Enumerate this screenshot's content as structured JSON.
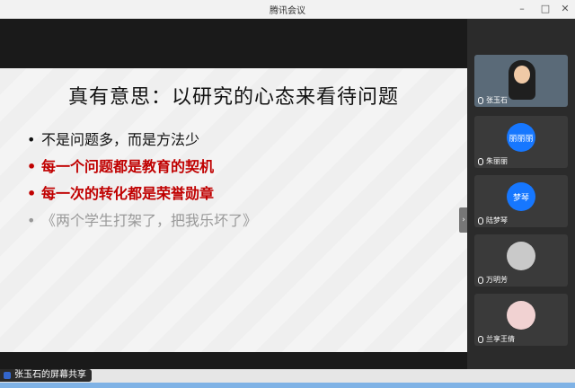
{
  "window": {
    "title": "腾讯会议",
    "controls": {
      "minimize": "–",
      "maximize": "□",
      "close": "✕"
    }
  },
  "slide": {
    "title": "真有意思：以研究的心态来看待问题",
    "bullets": [
      {
        "dot": "•",
        "text": "不是问题多，而是方法少"
      },
      {
        "dot": "•",
        "text": "每一个问题都是教育的契机"
      },
      {
        "dot": "•",
        "text": "每一次的转化都是荣誉勋章"
      },
      {
        "dot": "•",
        "text": "《两个学生打架了，把我乐坏了》"
      }
    ],
    "collapse_glyph": "›"
  },
  "participants": [
    {
      "name": "张玉石",
      "avatar_text": ""
    },
    {
      "name": "朱丽丽",
      "avatar_text": "丽丽丽"
    },
    {
      "name": "陆梦琴",
      "avatar_text": "梦琴"
    },
    {
      "name": "万明芳",
      "avatar_text": ""
    },
    {
      "name": "兰享王倩",
      "avatar_text": ""
    }
  ],
  "statusbar": {
    "share_label": "张玉石的屏幕共享"
  },
  "colors": {
    "highlight_red": "#c00000",
    "accent_blue": "#1677ff"
  }
}
